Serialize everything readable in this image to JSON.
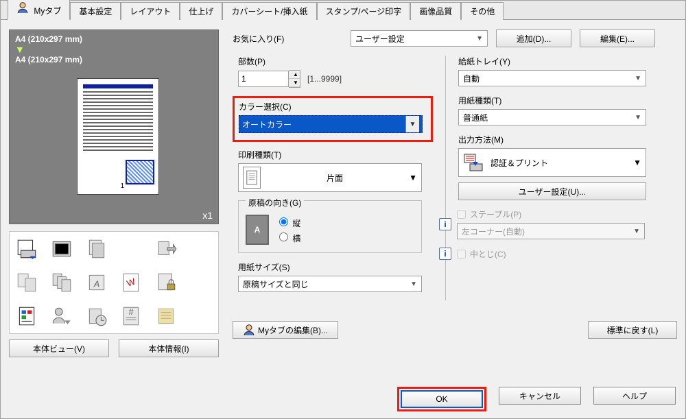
{
  "tabs": [
    "Myタブ",
    "基本設定",
    "レイアウト",
    "仕上げ",
    "カバーシート/挿入紙",
    "スタンプ/ページ印字",
    "画像品質",
    "その他"
  ],
  "preview": {
    "src_size": "A4 (210x297 mm)",
    "dst_size": "A4 (210x297 mm)",
    "arrow": "▼",
    "multiplier": "x1",
    "page_num": "1"
  },
  "left_buttons": {
    "body_view": "本体ビュー(V)",
    "body_info": "本体情報(I)"
  },
  "favorites": {
    "label": "お気に入り(F)",
    "value": "ユーザー設定",
    "add": "追加(D)...",
    "edit": "編集(E)..."
  },
  "copies": {
    "label": "部数(P)",
    "value": "1",
    "range": "[1...9999]"
  },
  "color": {
    "label": "カラー選択(C)",
    "value": "オートカラー"
  },
  "print_type": {
    "label": "印刷種類(T)",
    "value": "片面"
  },
  "orientation": {
    "label": "原稿の向き(G)",
    "portrait": "縦",
    "landscape": "横",
    "icon_letter": "A"
  },
  "paper_size": {
    "label": "用紙サイズ(S)",
    "value": "原稿サイズと同じ"
  },
  "tray": {
    "label": "給紙トレイ(Y)",
    "value": "自動"
  },
  "paper_type": {
    "label": "用紙種類(T)",
    "value": "普通紙"
  },
  "output": {
    "label": "出力方法(M)",
    "value": "認証＆プリント",
    "user_settings_btn": "ユーザー設定(U)..."
  },
  "staple": {
    "label": "ステープル(P)",
    "value": "左コーナー(自動)"
  },
  "saddle": {
    "label": "中とじ(C)"
  },
  "footer": {
    "mytab_edit": "Myタブの編集(B)...",
    "reset": "標準に戻す(L)"
  },
  "dialog": {
    "ok": "OK",
    "cancel": "キャンセル",
    "help": "ヘルプ"
  },
  "info_glyph": "i"
}
